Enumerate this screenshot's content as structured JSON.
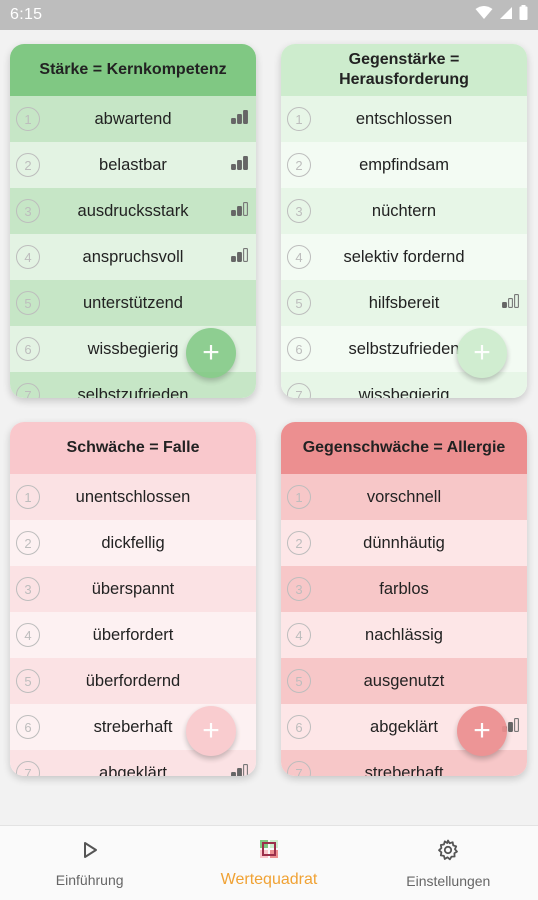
{
  "status_bar": {
    "time": "6:15"
  },
  "colors": {
    "green_header": "#80c883",
    "green_row_a": "#c6e6c6",
    "green_row_b": "#e3f3e3",
    "lightgreen_header": "#cdeccd",
    "lightgreen_row_a": "#e7f6e7",
    "lightgreen_row_b": "#f3fbf3",
    "pink_header": "#f9c8cc",
    "pink_row_a": "#fbe2e4",
    "pink_row_b": "#fdf1f2",
    "red_header": "#ec8f90",
    "red_row_a": "#f7c7c8",
    "red_row_b": "#fde6e7",
    "accent": "#f0a234"
  },
  "cards": {
    "staerke": {
      "title": "Stärke = Kernkompetenz",
      "items": [
        {
          "num": "1",
          "label": "abwartend",
          "signal": 3
        },
        {
          "num": "2",
          "label": "belastbar",
          "signal": 3
        },
        {
          "num": "3",
          "label": "ausdrucksstark",
          "signal": 2
        },
        {
          "num": "4",
          "label": "anspruchsvoll",
          "signal": 2
        },
        {
          "num": "5",
          "label": "unterstützend",
          "signal": 0
        },
        {
          "num": "6",
          "label": "wissbegierig",
          "signal": 0
        },
        {
          "num": "7",
          "label": "selbstzufrieden",
          "signal": 0
        }
      ],
      "fab": "+"
    },
    "gegenstaerke": {
      "title": "Gegenstärke = Herausforderung",
      "items": [
        {
          "num": "1",
          "label": "entschlossen",
          "signal": 0
        },
        {
          "num": "2",
          "label": "empfindsam",
          "signal": 0
        },
        {
          "num": "3",
          "label": "nüchtern",
          "signal": 0
        },
        {
          "num": "4",
          "label": "selektiv fordernd",
          "signal": 0
        },
        {
          "num": "5",
          "label": "hilfsbereit",
          "signal": 1
        },
        {
          "num": "6",
          "label": "selbstzufrieden",
          "signal": 0
        },
        {
          "num": "7",
          "label": "wissbegierig",
          "signal": 0
        }
      ],
      "fab": "+"
    },
    "schwaeche": {
      "title": "Schwäche = Falle",
      "items": [
        {
          "num": "1",
          "label": "unentschlossen",
          "signal": 0
        },
        {
          "num": "2",
          "label": "dickfellig",
          "signal": 0
        },
        {
          "num": "3",
          "label": "überspannt",
          "signal": 0
        },
        {
          "num": "4",
          "label": "überfordert",
          "signal": 0
        },
        {
          "num": "5",
          "label": "überfordernd",
          "signal": 0
        },
        {
          "num": "6",
          "label": "streberhaft",
          "signal": 0
        },
        {
          "num": "7",
          "label": "abgeklärt",
          "signal": 2
        }
      ],
      "fab": "+"
    },
    "gegenschwaeche": {
      "title": "Gegenschwäche = Allergie",
      "items": [
        {
          "num": "1",
          "label": "vorschnell",
          "signal": 0
        },
        {
          "num": "2",
          "label": "dünnhäutig",
          "signal": 0
        },
        {
          "num": "3",
          "label": "farblos",
          "signal": 0
        },
        {
          "num": "4",
          "label": "nachlässig",
          "signal": 0
        },
        {
          "num": "5",
          "label": "ausgenutzt",
          "signal": 0
        },
        {
          "num": "6",
          "label": "abgeklärt",
          "signal": 2
        },
        {
          "num": "7",
          "label": "streberhaft",
          "signal": 0
        }
      ],
      "fab": "+"
    }
  },
  "nav": {
    "items": [
      {
        "label": "Einführung",
        "icon": "play-icon"
      },
      {
        "label": "Wertequadrat",
        "icon": "wertequadrat-icon"
      },
      {
        "label": "Einstellungen",
        "icon": "gear-icon"
      }
    ],
    "active_index": 1
  }
}
